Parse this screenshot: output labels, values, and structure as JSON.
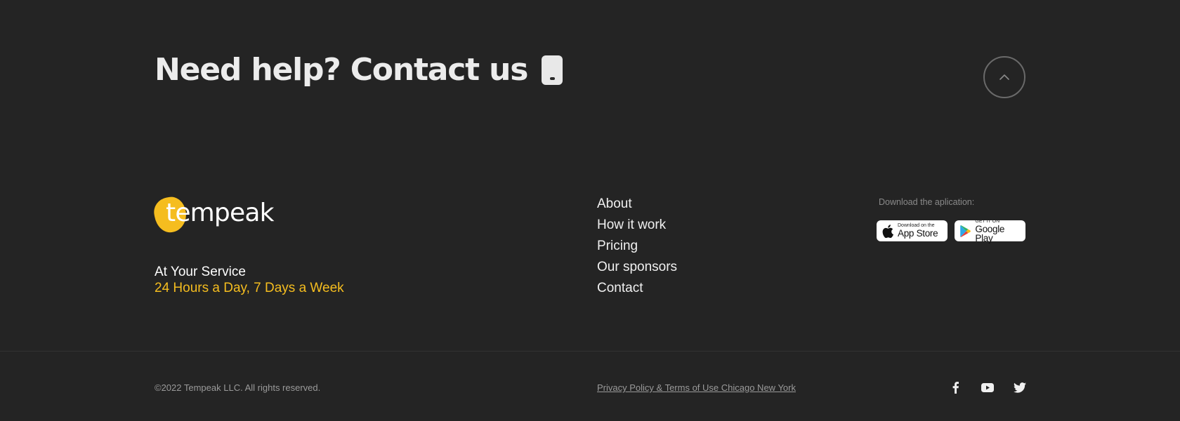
{
  "contact": {
    "heading": "Need help? Contact us",
    "phone_icon": "phone-icon",
    "scroll_top_icon": "chevron-up-icon"
  },
  "brand": {
    "logo_text": "tempeak",
    "accent": "#f5bd1f",
    "service_line1": "At Your Service",
    "service_line2": "24 Hours a Day, 7 Days a Week"
  },
  "nav": {
    "items": [
      {
        "label": "About"
      },
      {
        "label": "How it work"
      },
      {
        "label": "Pricing"
      },
      {
        "label": "Our sponsors"
      },
      {
        "label": "Contact"
      }
    ]
  },
  "download": {
    "label": "Download the aplication:",
    "app_store": {
      "small": "Download on the",
      "big": "App Store",
      "icon": "apple-icon"
    },
    "google_play": {
      "small": "GET IT ON",
      "big": "Google Play",
      "icon": "google-play-icon"
    }
  },
  "footer": {
    "copyright": "©2022 Tempeak LLC. All rights reserved.",
    "legal": "Privacy Policy & Terms of Use Chicago New York",
    "social": [
      "facebook-icon",
      "youtube-icon",
      "twitter-icon"
    ]
  }
}
